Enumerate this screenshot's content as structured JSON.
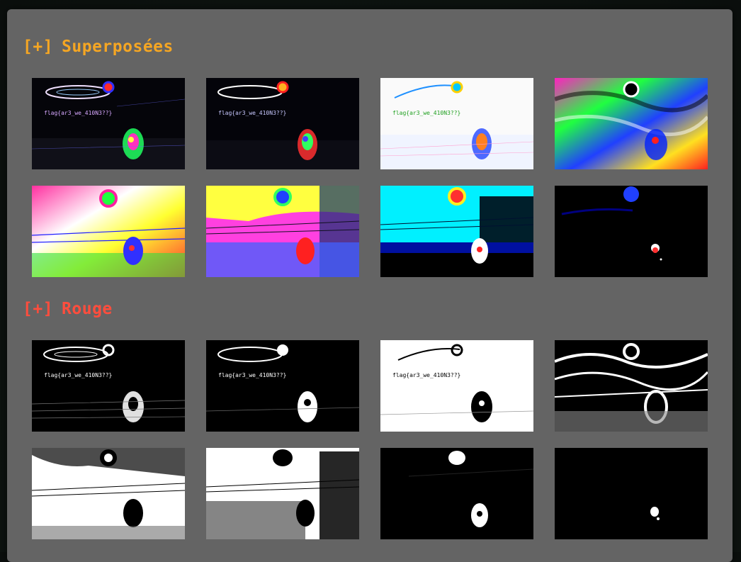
{
  "sections": [
    {
      "prefix": "[+]",
      "title": "Superposées",
      "color": "#f5a623"
    },
    {
      "prefix": "[+]",
      "title": "Rouge",
      "color": "#ff4d3d"
    }
  ],
  "flag_text": "flag{ar3_we_410N3??}"
}
